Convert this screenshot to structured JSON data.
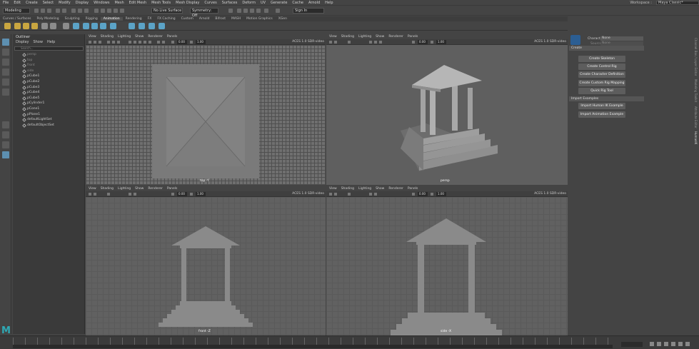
{
  "menubar": {
    "items": [
      "File",
      "Edit",
      "Create",
      "Select",
      "Modify",
      "Display",
      "Windows",
      "Mesh",
      "Edit Mesh",
      "Mesh Tools",
      "Mesh Display",
      "Curves",
      "Surfaces",
      "Deform",
      "UV",
      "Generate",
      "Cache",
      "Arnold",
      "Help"
    ],
    "workspace_label": "Workspace :",
    "workspace_value": "Maya Classic*"
  },
  "statusline": {
    "mode": "Modeling",
    "live_surface": "No Live Surface",
    "symmetry": "Symmetry: Off",
    "sign_in": "Sign In"
  },
  "shelf_tabs": [
    "Curves / Surfaces",
    "Poly Modeling",
    "Sculpting",
    "Rigging",
    "Animation",
    "Rendering",
    "FX",
    "FX Caching",
    "Custom",
    "Arnold",
    "Bifrost",
    "MASH",
    "Motion Graphics",
    "XGen"
  ],
  "shelf_active": "Animation",
  "outliner": {
    "title": "Outliner",
    "menu": [
      "Display",
      "Show",
      "Help"
    ],
    "search_placeholder": "Search...",
    "items": [
      "persp",
      "top",
      "front",
      "side",
      "pCube1",
      "pCube2",
      "pCube3",
      "pCube4",
      "pCube5",
      "pCylinder1",
      "pCone1",
      "pPlane1",
      "defaultLightSet",
      "defaultObjectSet"
    ]
  },
  "viewport_menu": [
    "View",
    "Shading",
    "Lighting",
    "Show",
    "Renderer",
    "Panels"
  ],
  "viewport_toolbar": {
    "value_a": "0.00",
    "value_b": "1.00",
    "colorspace": "ACES 1.0 SDR-video"
  },
  "viewports": {
    "top": "top -Y",
    "persp": "persp",
    "front": "front -Z",
    "side": "side -X"
  },
  "hik": {
    "character_label": "Character",
    "character_value": "None",
    "source_label": "Source",
    "source_value": "None",
    "create_header": "Create",
    "create_buttons": [
      "Create Skeleton",
      "Create Control Rig",
      "Create Character Definition",
      "Create Custom Rig Mapping",
      "Quick Rig Tool"
    ],
    "import_header": "Import Examples",
    "import_buttons": [
      "Import Human IK Example",
      "Import Animation Example"
    ],
    "vertical_tabs": [
      "Channel Box / Layer Editor",
      "Modeling Toolkit",
      "Attribute Editor",
      "HumanIK"
    ]
  },
  "colors": {
    "accent": "#5d8fb0",
    "logo": "#2ea9b5"
  }
}
